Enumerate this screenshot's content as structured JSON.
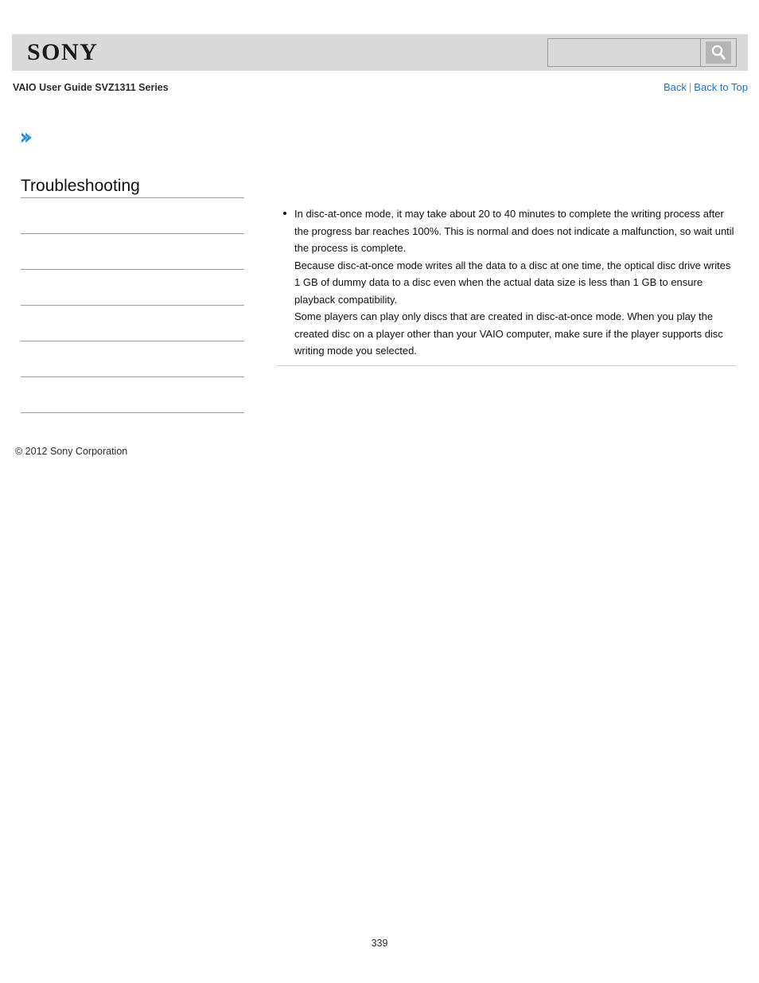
{
  "header": {
    "logo_text": "SONY",
    "logo_icon": "sony-wordmark",
    "search": {
      "value": "",
      "placeholder": "",
      "button_icon": "search-icon",
      "button_label": "Search"
    }
  },
  "subheader": {
    "doc_title": "VAIO User Guide SVZ1311 Series",
    "nav": {
      "back_label": "Back",
      "separator": "|",
      "back_to_top_label": "Back to Top"
    }
  },
  "sidebar": {
    "breadcrumb_icon": "chevron-right-icon",
    "heading": "Troubleshooting",
    "items": [
      {
        "label": ""
      },
      {
        "label": ""
      },
      {
        "label": ""
      },
      {
        "label": ""
      },
      {
        "label": ""
      },
      {
        "label": ""
      },
      {
        "label": ""
      }
    ]
  },
  "content": {
    "bullets": [
      {
        "paragraphs": [
          "In disc-at-once mode, it may take about 20 to 40 minutes to complete the writing process after the progress bar reaches 100%. This is normal and does not indicate a malfunction, so wait until the process is complete.",
          "Because disc-at-once mode writes all the data to a disc at one time, the optical disc drive writes 1 GB of dummy data to a disc even when the actual data size is less than 1 GB to ensure playback compatibility.",
          "Some players can play only discs that are created in disc-at-once mode. When you play the created disc on a player other than your VAIO computer, make sure if the player supports disc writing mode you selected."
        ]
      }
    ]
  },
  "footer": {
    "copyright": "© 2012 Sony Corporation",
    "page_number": "339"
  },
  "colors": {
    "header_bg": "#d9d9d9",
    "link": "#1f6fc4",
    "accent_arrow": "#2a8fd4",
    "rule": "#9b9b9b"
  }
}
